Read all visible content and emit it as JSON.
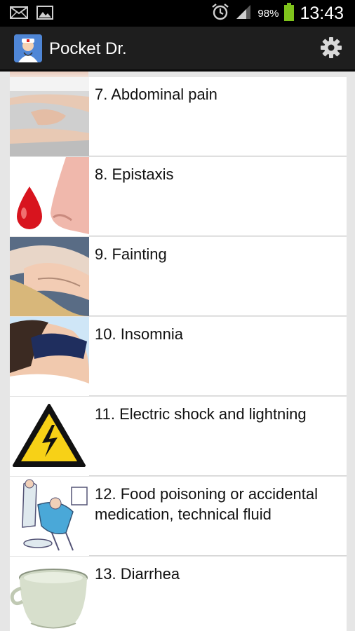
{
  "status_bar": {
    "battery_percent": "98%",
    "time": "13:43",
    "icons": [
      "mail-icon",
      "image-icon",
      "alarm-icon",
      "signal-icon",
      "battery-icon"
    ]
  },
  "app": {
    "title": "Pocket Dr.",
    "settings_icon": "gear-icon"
  },
  "list": {
    "items": [
      {
        "label": "7. Abdominal pain",
        "thumb": "abdominal-pain-photo"
      },
      {
        "label": "8. Epistaxis",
        "thumb": "nosebleed-illustration"
      },
      {
        "label": "9. Fainting",
        "thumb": "fainting-photo"
      },
      {
        "label": "10. Insomnia",
        "thumb": "sleep-mask-photo"
      },
      {
        "label": "11. Electric shock and lightning",
        "thumb": "high-voltage-sign"
      },
      {
        "label": "12. Food poisoning or accidental medication, technical fluid",
        "thumb": "vomiting-illustration"
      },
      {
        "label": "13. Diarrhea",
        "thumb": "chamber-pot-photo"
      }
    ]
  },
  "colors": {
    "status_bar_bg": "#000000",
    "action_bar_bg": "#1e1e1e",
    "list_bg": "#e6e6e6",
    "row_bg": "#ffffff",
    "battery_green": "#7fc31c",
    "warning_yellow": "#f7d117"
  }
}
